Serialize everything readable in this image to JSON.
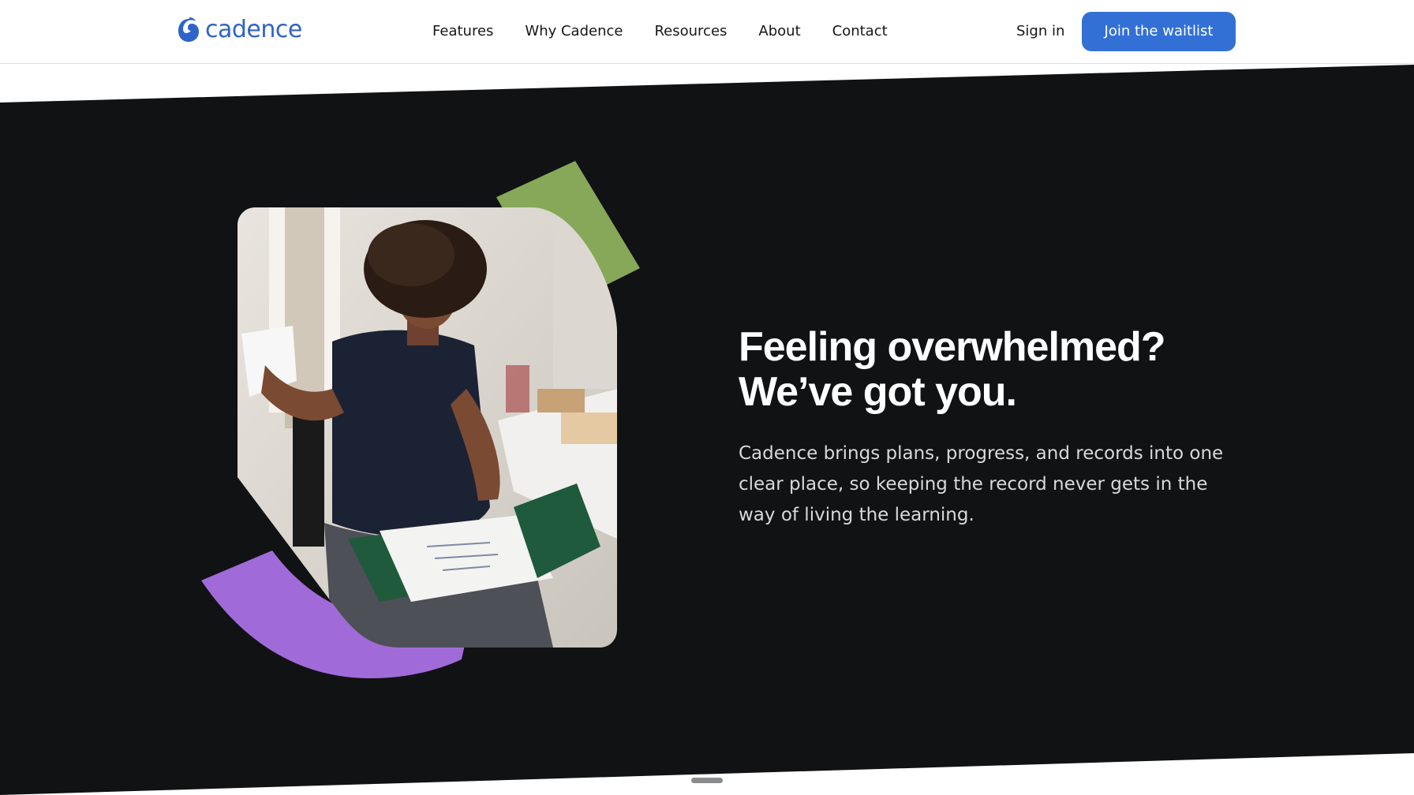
{
  "brand": {
    "name": "cadence",
    "logo_icon": "cadence-swirl-icon",
    "color": "#2e63c9"
  },
  "nav": {
    "links": [
      "Features",
      "Why Cadence",
      "Resources",
      "About",
      "Contact"
    ],
    "sign_in": "Sign in",
    "cta": "Join the waitlist",
    "cta_color": "#3370d6"
  },
  "hero": {
    "title_line1": "Feeling overwhelmed?",
    "title_line2": "We’ve got you.",
    "body": "Cadence brings plans, progress, and records into one clear place, so keeping the record never gets in the way of living the learning.",
    "background_color": "#111214",
    "accent_green": "#86a858",
    "accent_purple": "#a06bd8",
    "image": "photo of a stressed woman at a desk holding papers"
  }
}
